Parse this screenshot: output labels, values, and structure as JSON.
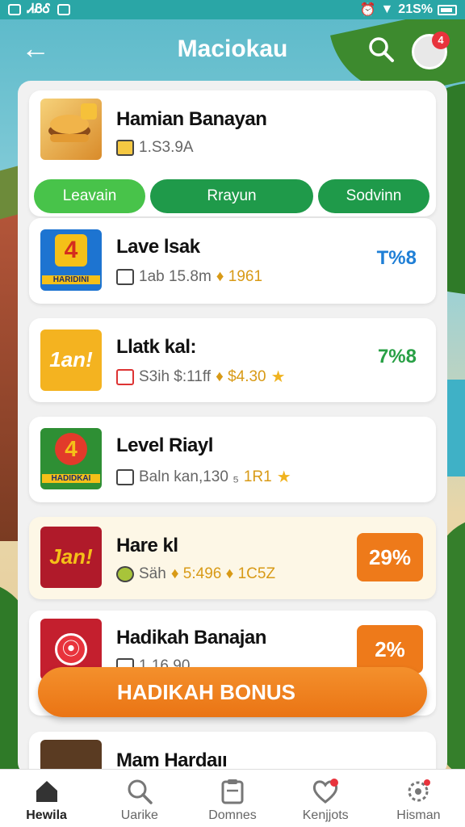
{
  "status_bar": {
    "left_text": "ᏗᏰᎴ",
    "right_text": "21S%"
  },
  "header": {
    "title": "Maciokau",
    "avatar_badge": "4"
  },
  "list": [
    {
      "name": "Hamian Banayan",
      "meta": "1.S3.9A",
      "actions": [
        "Leavain",
        "Rrayun",
        "Sodvinn"
      ]
    },
    {
      "name": "Lave lsak",
      "meta_a": "1ab 15.8m",
      "meta_b": "♦ 1961",
      "percent": "T%8",
      "percent_color": "#1f7fd6",
      "icon_text": "4",
      "icon_sub": "HARIDINI"
    },
    {
      "name": "Llatk kal:",
      "meta_a": "S3ih $:11ff",
      "meta_b": "♦ $4.30",
      "percent": "7%8",
      "percent_color": "#28a045",
      "icon_text": "1an!"
    },
    {
      "name": "Level Riayl",
      "meta_a": "Baln kan,130 ₅",
      "meta_b": "1R1",
      "icon_text": "4",
      "icon_sub": "HADIDKAI"
    },
    {
      "name": "Hare kl",
      "meta_a": "Säh",
      "meta_b": "♦ 5:496  ♦ 1C5Z",
      "percent": "29%",
      "icon_text": "Jan!"
    },
    {
      "name": "Hadikah Banajan",
      "meta_a": "1.16.90",
      "percent": "2%",
      "icon_text": "⦿"
    },
    {
      "name": "Mam Hardaıı"
    }
  ],
  "bonus_button": "HADIKAH BONUS",
  "nav": [
    {
      "label": "Hewila",
      "icon": "home-icon"
    },
    {
      "label": "Uarike",
      "icon": "search-icon"
    },
    {
      "label": "Domnes",
      "icon": "clipboard-icon"
    },
    {
      "label": "Kenjjots",
      "icon": "heart-icon"
    },
    {
      "label": "Hisman",
      "icon": "settings-icon"
    }
  ],
  "colors": {
    "primary_green": "#1f9a4a",
    "light_green": "#48c34a",
    "orange": "#ee7a1a",
    "teal": "#2aa6a6"
  }
}
